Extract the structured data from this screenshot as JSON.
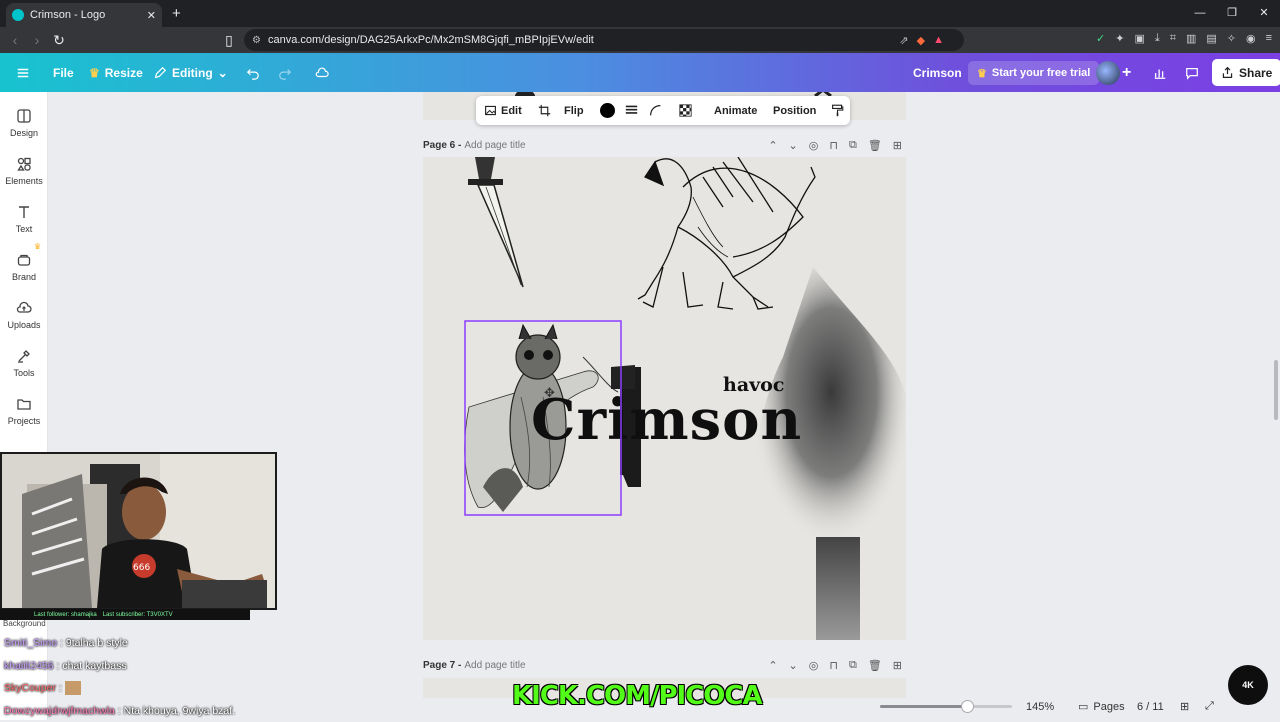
{
  "browser": {
    "tab_title": "Crimson - Logo",
    "new_tab": "+",
    "url": "canva.com/design/DAG25ArkxPc/Mx2mSM8Gjqfi_mBPIpjEVw/edit",
    "min": "—",
    "max": "❐",
    "close": "✕"
  },
  "topbar": {
    "file": "File",
    "resize": "Resize",
    "editing": "Editing",
    "design_name": "Crimson",
    "trial": "Start your free trial",
    "share": "Share"
  },
  "sidebar": {
    "items": [
      {
        "label": "Design",
        "icon": "design-icon"
      },
      {
        "label": "Elements",
        "icon": "elements-icon"
      },
      {
        "label": "Text",
        "icon": "text-icon"
      },
      {
        "label": "Brand",
        "icon": "brand-icon"
      },
      {
        "label": "Uploads",
        "icon": "uploads-icon"
      },
      {
        "label": "Tools",
        "icon": "tools-icon"
      },
      {
        "label": "Projects",
        "icon": "projects-icon"
      }
    ]
  },
  "context_toolbar": {
    "edit": "Edit",
    "flip": "Flip",
    "animate": "Animate",
    "position": "Position"
  },
  "pages": [
    {
      "label": "Page 6 -",
      "placeholder": "Add page title"
    },
    {
      "label": "Page 7 -",
      "placeholder": "Add page title"
    }
  ],
  "canvas": {
    "title": "Crimson",
    "tagline": "havoc"
  },
  "stream": {
    "last_follower": "Last follower: shamajka",
    "last_subscriber": "Last subscriber: T3V0XTV",
    "background_label": "Background",
    "chat": [
      {
        "user": "Smiti_Simo",
        "msg": ": 9talha b style"
      },
      {
        "user": "khalili2456",
        "msg": ": chat kaytbass"
      },
      {
        "user": "SkyCouper",
        "msg": ":"
      },
      {
        "user": "Dowzywajdrwjfmachwla",
        "msg": ": Nta khouya, 9wiya bzaf."
      }
    ],
    "overlay": "KICK.COM/PICOCA",
    "badge": "4K"
  },
  "bottombar": {
    "zoom": "145%",
    "zoom_fraction": 0.66,
    "pages_label": "Pages",
    "page_count": "6 / 11"
  },
  "colors": {
    "accent": "#8b3dff",
    "selection": "#8b3dff",
    "kick_green": "#53fc18"
  }
}
